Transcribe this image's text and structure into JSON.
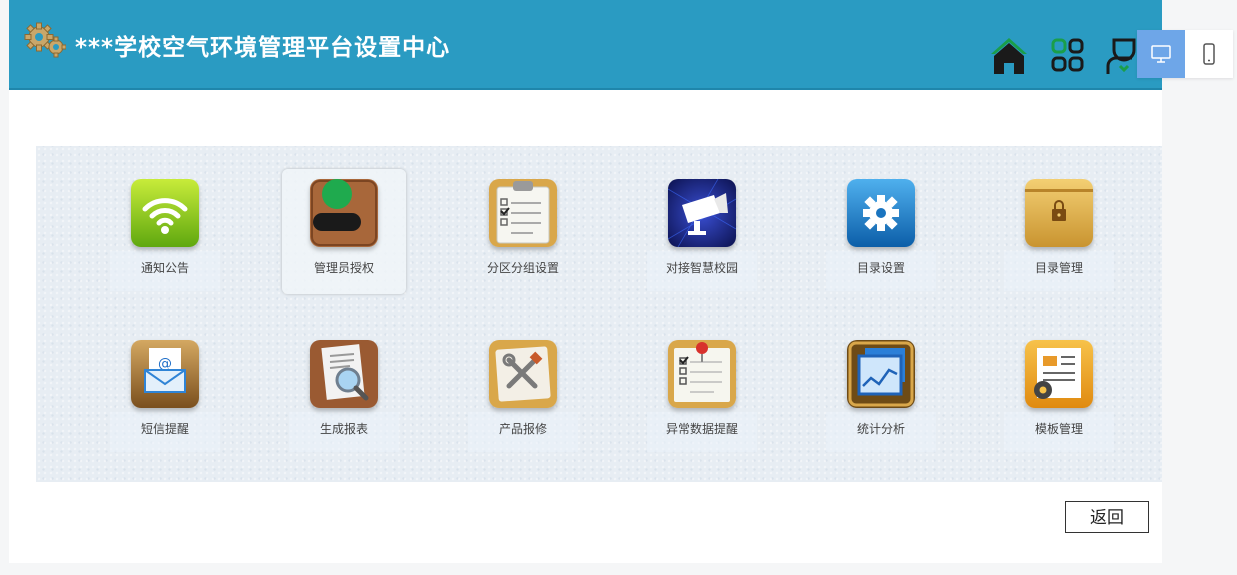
{
  "header": {
    "title": "***学校空气环境管理平台设置中心",
    "icons": [
      "home-icon",
      "apps-grid-icon",
      "user-icon"
    ]
  },
  "device_toggle": {
    "options": [
      "desktop-icon",
      "mobile-icon"
    ],
    "selected": "desktop"
  },
  "menu": [
    {
      "label": "通知公告",
      "icon": "wifi-icon"
    },
    {
      "label": "管理员授权",
      "icon": "book-icon"
    },
    {
      "label": "分区分组设置",
      "icon": "clipboard-icon"
    },
    {
      "label": "对接智慧校园",
      "icon": "camera-icon"
    },
    {
      "label": "目录设置",
      "icon": "gear-icon"
    },
    {
      "label": "目录管理",
      "icon": "folder-lock-icon"
    },
    {
      "label": "短信提醒",
      "icon": "mail-icon"
    },
    {
      "label": "生成报表",
      "icon": "report-search-icon"
    },
    {
      "label": "产品报修",
      "icon": "tools-icon"
    },
    {
      "label": "异常数据提醒",
      "icon": "checklist-pin-icon"
    },
    {
      "label": "统计分析",
      "icon": "chart-window-icon"
    },
    {
      "label": "模板管理",
      "icon": "template-icon"
    }
  ],
  "actions": {
    "back_label": "返回"
  },
  "colors": {
    "header_bg": "#2a9bc2",
    "panel_bg": "#e7edf3",
    "toggle_active": "#6ea6e8"
  }
}
